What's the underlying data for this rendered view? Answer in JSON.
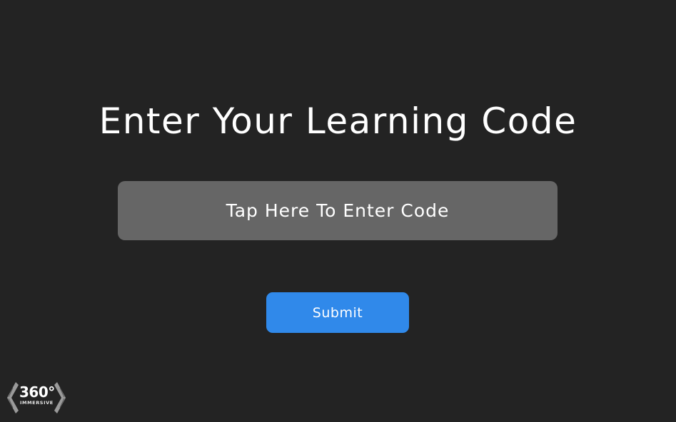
{
  "screen": {
    "title": "Enter Your Learning Code",
    "code_input": {
      "placeholder": "Tap Here To Enter Code",
      "value": ""
    },
    "submit_label": "Submit"
  },
  "logo": {
    "number": "360°",
    "subtitle": "IMMERSIVE"
  },
  "colors": {
    "background": "#232323",
    "input_background": "#666666",
    "accent": "#3089ea",
    "text": "#ffffff"
  }
}
